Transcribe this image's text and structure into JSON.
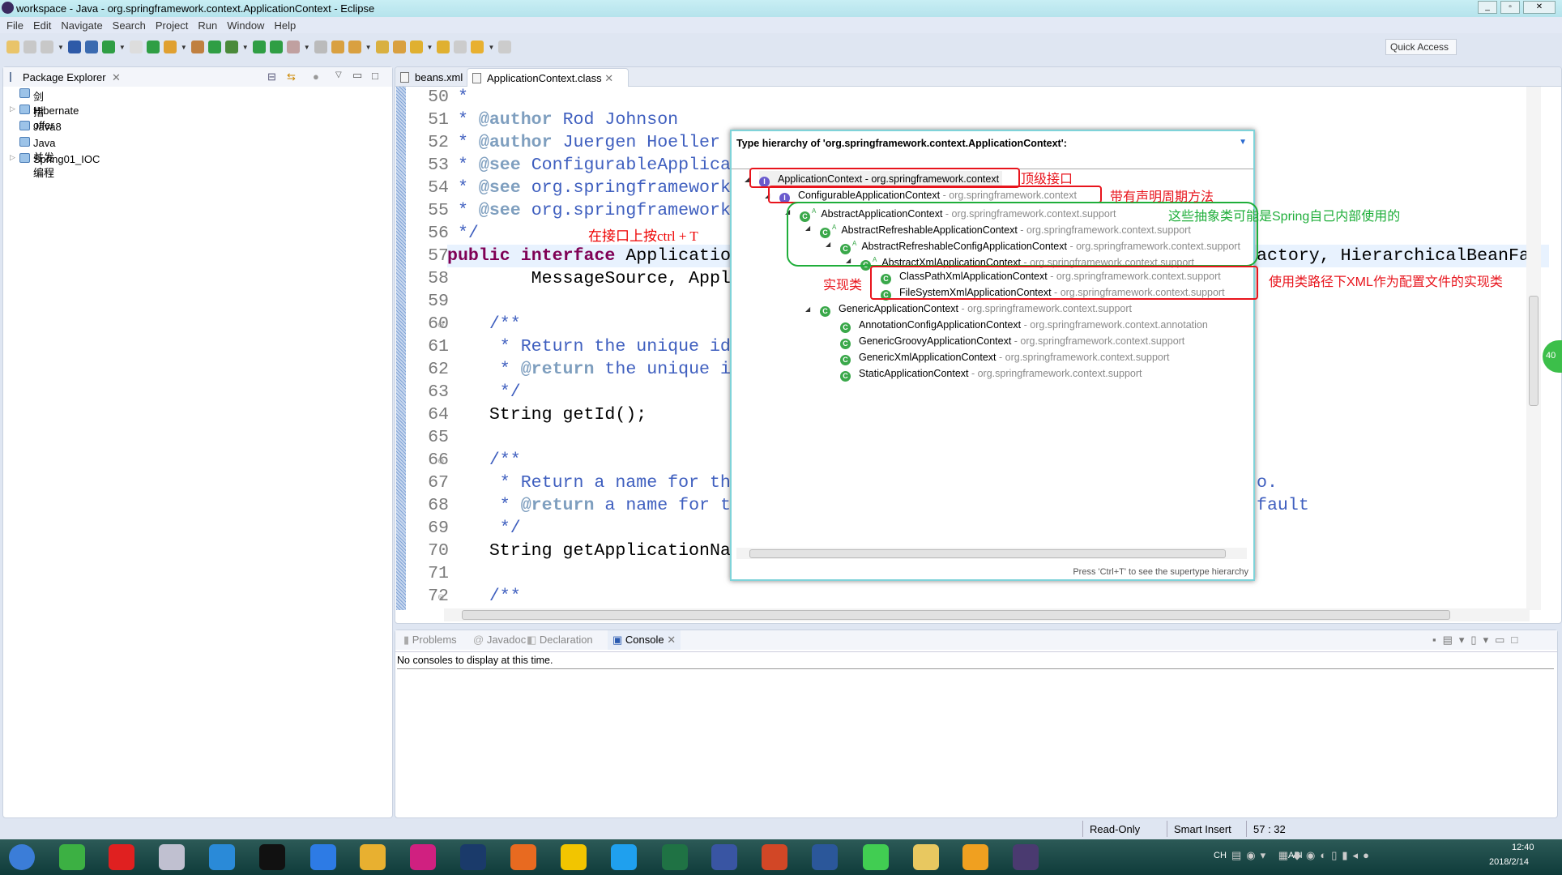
{
  "window": {
    "title": "workspace - Java - org.springframework.context.ApplicationContext - Eclipse",
    "controls": [
      "minimize",
      "maximize",
      "close"
    ]
  },
  "menu": [
    "File",
    "Edit",
    "Navigate",
    "Search",
    "Project",
    "Run",
    "Window",
    "Help"
  ],
  "toolbar": {
    "icons": [
      {
        "name": "new",
        "color": "#e9c46a"
      },
      {
        "name": "save",
        "color": "#c8c8c8"
      },
      {
        "name": "save-all",
        "color": "#c8c8c8"
      },
      {
        "name": "terminal",
        "color": "#2e5aa8"
      },
      {
        "name": "skip-breakpoints",
        "color": "#3a6ab0"
      },
      {
        "name": "spring-boot",
        "color": "#2f9e44"
      },
      {
        "name": "toggle-mark",
        "color": "#ddd"
      },
      {
        "name": "refresh-errors",
        "color": "#2f9e44"
      },
      {
        "name": "new-java-project",
        "color": "#e0a030"
      },
      {
        "name": "new-package",
        "color": "#c08040"
      },
      {
        "name": "new-class",
        "color": "#2f9e44"
      },
      {
        "name": "debug",
        "color": "#4a8a3a"
      },
      {
        "name": "run",
        "color": "#2f9e44"
      },
      {
        "name": "run-external",
        "color": "#2f9e44"
      },
      {
        "name": "stop",
        "color": "#c0a0a0"
      },
      {
        "name": "deploy",
        "color": "#bbb"
      },
      {
        "name": "open-type",
        "color": "#d9a040"
      },
      {
        "name": "open-resource",
        "color": "#d9a040"
      },
      {
        "name": "search",
        "color": "#d9b040"
      },
      {
        "name": "open-task",
        "color": "#d9a040"
      },
      {
        "name": "next-annotation",
        "color": "#e0b030"
      },
      {
        "name": "prev-annotation",
        "color": "#e0b030"
      },
      {
        "name": "last-edit",
        "color": "#ccc"
      },
      {
        "name": "back",
        "color": "#e8b030"
      },
      {
        "name": "forward",
        "color": "#ccc"
      }
    ],
    "quick_access": "Quick Access"
  },
  "package_explorer": {
    "title": "Package Explorer",
    "items": [
      {
        "label": "剑指offer",
        "expandable": false
      },
      {
        "label": "Hibernate",
        "expandable": true
      },
      {
        "label": "Java8",
        "expandable": false
      },
      {
        "label": "Java并发编程",
        "expandable": false
      },
      {
        "label": "Spring01_IOC",
        "expandable": true
      }
    ]
  },
  "editor": {
    "tabs": [
      {
        "label": "beans.xml",
        "active": false
      },
      {
        "label": "ApplicationContext.class",
        "active": true
      }
    ],
    "highlight_line": 57,
    "lines": [
      {
        "n": "50",
        "s": [
          [
            "comment",
            " *"
          ]
        ]
      },
      {
        "n": "51",
        "s": [
          [
            "comment",
            " * "
          ],
          [
            "tag",
            "@author"
          ],
          [
            "comment",
            " Rod Johnson"
          ]
        ]
      },
      {
        "n": "52",
        "s": [
          [
            "comment",
            " * "
          ],
          [
            "tag",
            "@author"
          ],
          [
            "comment",
            " Juergen Hoeller"
          ]
        ]
      },
      {
        "n": "53",
        "s": [
          [
            "comment",
            " * "
          ],
          [
            "tag",
            "@see"
          ],
          [
            "comment",
            " ConfigurableApplica"
          ]
        ]
      },
      {
        "n": "54",
        "s": [
          [
            "comment",
            " * "
          ],
          [
            "tag",
            "@see"
          ],
          [
            "comment",
            " org.springframework"
          ]
        ]
      },
      {
        "n": "55",
        "s": [
          [
            "comment",
            " * "
          ],
          [
            "tag",
            "@see"
          ],
          [
            "comment",
            " org.springframework"
          ]
        ]
      },
      {
        "n": "56",
        "s": [
          [
            "comment",
            " */"
          ]
        ]
      },
      {
        "n": "57",
        "s": [
          [
            "kw",
            "public"
          ],
          [
            "plain",
            " "
          ],
          [
            "kw",
            "interface"
          ],
          [
            "plain",
            " Applicatio"
          ]
        ]
      },
      {
        "n": "58",
        "s": [
          [
            "plain",
            "        MessageSource, Appl"
          ]
        ]
      },
      {
        "n": "59",
        "s": []
      },
      {
        "n": "60",
        "fold": true,
        "s": [
          [
            "comment",
            "    /**"
          ]
        ]
      },
      {
        "n": "61",
        "s": [
          [
            "comment",
            "     * Return the unique id"
          ]
        ]
      },
      {
        "n": "62",
        "s": [
          [
            "comment",
            "     * "
          ],
          [
            "tag",
            "@return"
          ],
          [
            "comment",
            " the unique i"
          ]
        ]
      },
      {
        "n": "63",
        "s": [
          [
            "comment",
            "     */"
          ]
        ]
      },
      {
        "n": "64",
        "s": [
          [
            "plain",
            "    String getId();"
          ]
        ]
      },
      {
        "n": "65",
        "s": []
      },
      {
        "n": "66",
        "fold": true,
        "s": [
          [
            "comment",
            "    /**"
          ]
        ]
      },
      {
        "n": "67",
        "s": [
          [
            "comment",
            "     * Return a name for th"
          ]
        ]
      },
      {
        "n": "68",
        "s": [
          [
            "comment",
            "     * "
          ],
          [
            "tag",
            "@return"
          ],
          [
            "comment",
            " a name for t"
          ]
        ]
      },
      {
        "n": "69",
        "s": [
          [
            "comment",
            "     */"
          ]
        ]
      },
      {
        "n": "70",
        "s": [
          [
            "plain",
            "    String getApplicationNa"
          ]
        ]
      },
      {
        "n": "71",
        "s": []
      },
      {
        "n": "72",
        "fold": true,
        "s": [
          [
            "comment",
            "    /**"
          ]
        ]
      }
    ],
    "right_fragments": [
      {
        "line": 57,
        "text": "actory, HierarchicalBeanFa",
        "kind": "plain"
      },
      {
        "line": 67,
        "text": "o.",
        "kind": "comment"
      },
      {
        "line": 68,
        "text": "fault",
        "kind": "comment"
      }
    ]
  },
  "type_hierarchy": {
    "title": "Type hierarchy of 'org.springframework.context.ApplicationContext':",
    "footer": "Press 'Ctrl+T' to see the supertype hierarchy",
    "rows": [
      {
        "depth": 0,
        "name": "ApplicationContext",
        "pkg": "org.springframework.context",
        "icon": "interface",
        "expanded": true,
        "selected": true
      },
      {
        "depth": 1,
        "name": "ConfigurableApplicationContext",
        "pkg": "org.springframework.context",
        "icon": "interface",
        "expanded": true
      },
      {
        "depth": 2,
        "name": "AbstractApplicationContext",
        "pkg": "org.springframework.context.support",
        "icon": "abstract-class",
        "expanded": true
      },
      {
        "depth": 3,
        "name": "AbstractRefreshableApplicationContext",
        "pkg": "org.springframework.context.support",
        "icon": "abstract-class",
        "expanded": true
      },
      {
        "depth": 4,
        "name": "AbstractRefreshableConfigApplicationContext",
        "pkg": "org.springframework.context.support",
        "icon": "abstract-class",
        "expanded": true
      },
      {
        "depth": 5,
        "name": "AbstractXmlApplicationContext",
        "pkg": "org.springframework.context.support",
        "icon": "abstract-class",
        "expanded": true
      },
      {
        "depth": 6,
        "name": "ClassPathXmlApplicationContext",
        "pkg": "org.springframework.context.support",
        "icon": "class",
        "expanded": false
      },
      {
        "depth": 6,
        "name": "FileSystemXmlApplicationContext",
        "pkg": "org.springframework.context.support",
        "icon": "class",
        "expanded": false
      },
      {
        "depth": 3,
        "name": "GenericApplicationContext",
        "pkg": "org.springframework.context.support",
        "icon": "class",
        "expanded": true
      },
      {
        "depth": 4,
        "name": "AnnotationConfigApplicationContext",
        "pkg": "org.springframework.context.annotation",
        "icon": "class",
        "expanded": false
      },
      {
        "depth": 4,
        "name": "GenericGroovyApplicationContext",
        "pkg": "org.springframework.context.support",
        "icon": "class",
        "expanded": false
      },
      {
        "depth": 4,
        "name": "GenericXmlApplicationContext",
        "pkg": "org.springframework.context.support",
        "icon": "class",
        "expanded": false
      },
      {
        "depth": 4,
        "name": "StaticApplicationContext",
        "pkg": "org.springframework.context.support",
        "icon": "class",
        "expanded": false
      }
    ]
  },
  "annotations": {
    "ctrl_t": "在接口上按ctrl + T",
    "top_interface": "顶级接口",
    "lifecycle": "带有声明周期方法",
    "abstract_internal": "这些抽象类可能是Spring自己内部使用的",
    "impl": "实现类",
    "xml_impl": "使用类路径下XML作为配置文件的实现类",
    "colors": {
      "red": "#e8141c",
      "green": "#1fae3a"
    }
  },
  "bottom_panel": {
    "tabs": [
      {
        "label": "Problems",
        "active": false
      },
      {
        "label": "Javadoc",
        "active": false
      },
      {
        "label": "Declaration",
        "active": false
      },
      {
        "label": "Console",
        "active": true
      }
    ],
    "message": "No consoles to display at this time."
  },
  "status": {
    "mode": "Read-Only",
    "insert": "Smart Insert",
    "position": "57 : 32"
  },
  "taskbar": {
    "apps": [
      {
        "name": "start",
        "color": "#3b7dd8"
      },
      {
        "name": "360",
        "color": "#3cb043"
      },
      {
        "name": "netease-music",
        "color": "#e02020"
      },
      {
        "name": "snipping",
        "color": "#c0c0d0"
      },
      {
        "name": "internet-explorer",
        "color": "#2a8ad8"
      },
      {
        "name": "cmd",
        "color": "#111"
      },
      {
        "name": "feishu",
        "color": "#2d7be5"
      },
      {
        "name": "chrome",
        "color": "#e8b030"
      },
      {
        "name": "pen",
        "color": "#d02080"
      },
      {
        "name": "onenote",
        "color": "#1a3a6a"
      },
      {
        "name": "firefox",
        "color": "#e86a20"
      },
      {
        "name": "qq-music",
        "color": "#f2c500"
      },
      {
        "name": "baidu-netdisk",
        "color": "#1fa0ee"
      },
      {
        "name": "excel",
        "color": "#1f7244"
      },
      {
        "name": "visio",
        "color": "#3955a3"
      },
      {
        "name": "powerpoint",
        "color": "#d24726"
      },
      {
        "name": "word",
        "color": "#2b579a"
      },
      {
        "name": "qt",
        "color": "#41cd52"
      },
      {
        "name": "file-explorer",
        "color": "#e8c860"
      },
      {
        "name": "media-player",
        "color": "#f0a020"
      },
      {
        "name": "eclipse",
        "color": "#4a3a70"
      }
    ],
    "tray": {
      "lang": "CH",
      "api": "API",
      "time": "12:40",
      "date": "2018/2/14"
    }
  }
}
